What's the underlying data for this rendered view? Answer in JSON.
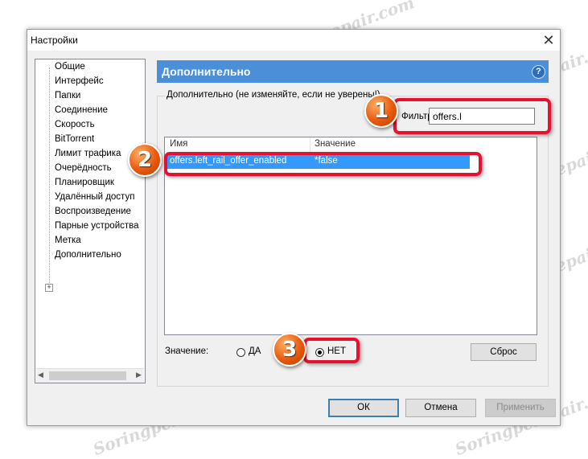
{
  "window": {
    "title": "Настройки",
    "close_glyph": "✕"
  },
  "sidebar": {
    "items": [
      {
        "label": "Общие"
      },
      {
        "label": "Интерфейс"
      },
      {
        "label": "Папки"
      },
      {
        "label": "Соединение"
      },
      {
        "label": "Скорость"
      },
      {
        "label": "BitTorrent"
      },
      {
        "label": "Лимит трафика"
      },
      {
        "label": "Очерёдность"
      },
      {
        "label": "Планировщик"
      },
      {
        "label": "Удалённый доступ"
      },
      {
        "label": "Воспроизведение"
      },
      {
        "label": "Парные устройства"
      },
      {
        "label": "Метка"
      },
      {
        "label": "Дополнительно"
      }
    ],
    "expander_glyph": "+",
    "scroll_left_glyph": "◀",
    "scroll_right_glyph": "▶"
  },
  "panel": {
    "title": "Дополнительно",
    "help_glyph": "?",
    "group_caption": "Дополнительно (не изменяйте, если не уверены!)",
    "filter_label": "Фильтр",
    "filter_value": "offers.l"
  },
  "table": {
    "columns": [
      "Имя",
      "Значение"
    ],
    "rows": [
      {
        "name": "offers.left_rail_offer_enabled",
        "value": "*false"
      }
    ]
  },
  "value_editor": {
    "label": "Значение:",
    "option_yes": "ДА",
    "option_no": "НЕТ",
    "selected": "НЕТ",
    "reset_label": "Сброс"
  },
  "footer": {
    "ok_label": "ОК",
    "cancel_label": "Отмена",
    "apply_label": "Применить"
  },
  "annotations": [
    "1",
    "2",
    "3"
  ],
  "watermark": "Soringpcrepair.com",
  "colors": {
    "header_bg": "#4a8fd8",
    "selection_bg": "#3399ff",
    "highlight": "#e8102f",
    "badge": "#e8590c"
  }
}
